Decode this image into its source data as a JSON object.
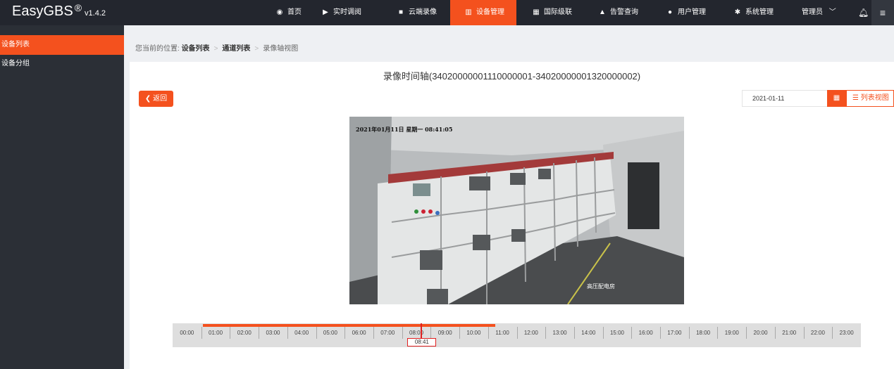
{
  "app": {
    "name": "EasyGBS",
    "reg": "®",
    "version": "v1.4.2"
  },
  "nav": {
    "items": [
      {
        "label": "首页",
        "icon": "dashboard-icon",
        "glyph": "◉"
      },
      {
        "label": "实时调阅",
        "icon": "play-circle-icon",
        "glyph": "▶"
      },
      {
        "label": "云端录像",
        "icon": "video-camera-icon",
        "glyph": "■"
      },
      {
        "label": "设备管理",
        "icon": "device-icon",
        "glyph": "▥"
      },
      {
        "label": "国际级联",
        "icon": "grid-icon",
        "glyph": "▦"
      },
      {
        "label": "告警查询",
        "icon": "alarm-icon",
        "glyph": "▲"
      },
      {
        "label": "用户管理",
        "icon": "user-icon",
        "glyph": "●"
      },
      {
        "label": "系统管理",
        "icon": "gear-icon",
        "glyph": "✱"
      }
    ],
    "active_index": 3,
    "admin_label": "管理员",
    "accent": "#f4511e"
  },
  "sidebar": {
    "items": [
      {
        "label": "设备列表"
      },
      {
        "label": "设备分组"
      }
    ],
    "active_index": 0
  },
  "breadcrumb": {
    "prefix": "您当前的位置:",
    "items": [
      "设备列表",
      "通道列表",
      "录像轴视图"
    ]
  },
  "page": {
    "title": "录像时间轴(34020000001110000001-34020000001320000002)",
    "back_label": "返回",
    "date_value": "2021-01-11",
    "list_view_label": "列表视图"
  },
  "video": {
    "osd_time": "2021年01月11日 星期一 08:41:05",
    "osd_label": "高压配电房"
  },
  "timeline": {
    "hours": [
      "00:00",
      "01:00",
      "02:00",
      "03:00",
      "04:00",
      "05:00",
      "06:00",
      "07:00",
      "08:00",
      "09:00",
      "10:00",
      "11:00",
      "12:00",
      "13:00",
      "14:00",
      "15:00",
      "16:00",
      "17:00",
      "18:00",
      "19:00",
      "20:00",
      "21:00",
      "22:00",
      "23:00"
    ],
    "recording_start_hour": 1.05,
    "recording_end_hour": 11.25,
    "cursor_hour": 8.68,
    "cursor_label": "08:41"
  }
}
